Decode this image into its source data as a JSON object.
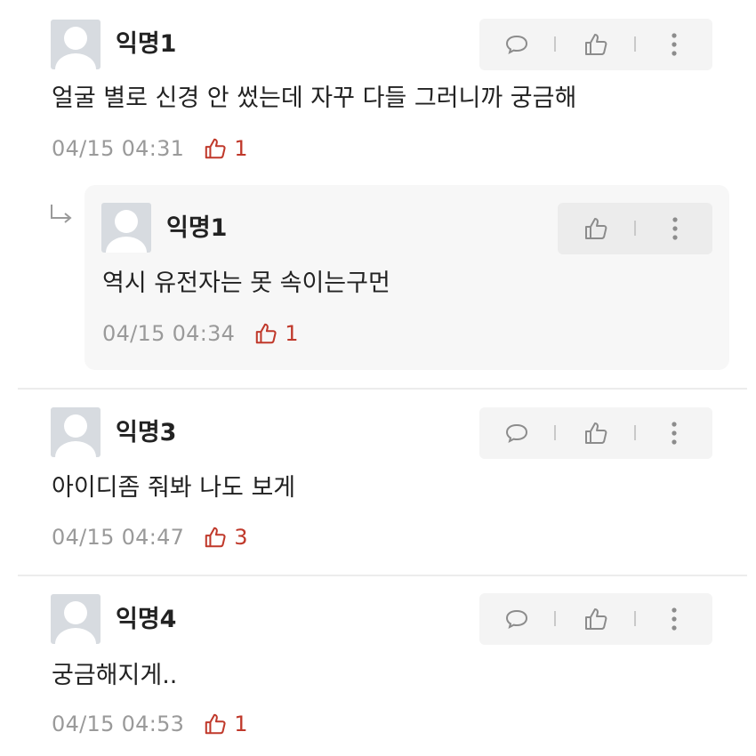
{
  "comments": [
    {
      "author": "익명1",
      "text": "얼굴 별로 신경 안 썼는데 자꾸 다들 그러니까 궁금해",
      "time": "04/15 04:31",
      "likes": "1"
    },
    {
      "author": "익명1",
      "text": "역시 유전자는 못 속이는구먼",
      "time": "04/15 04:34",
      "likes": "1",
      "is_reply": true
    },
    {
      "author": "익명3",
      "text": "아이디좀 줘봐 나도 보게",
      "time": "04/15 04:47",
      "likes": "3"
    },
    {
      "author": "익명4",
      "text": "궁금해지게..",
      "time": "04/15 04:53",
      "likes": "1"
    }
  ],
  "icons": {
    "comment": "speech-bubble-icon",
    "like": "thumbs-up-icon",
    "more": "more-vertical-icon",
    "reply": "reply-arrow-icon"
  },
  "colors": {
    "like_accent": "#c0392b",
    "meta_gray": "#9a9a9a",
    "text": "#222222"
  }
}
